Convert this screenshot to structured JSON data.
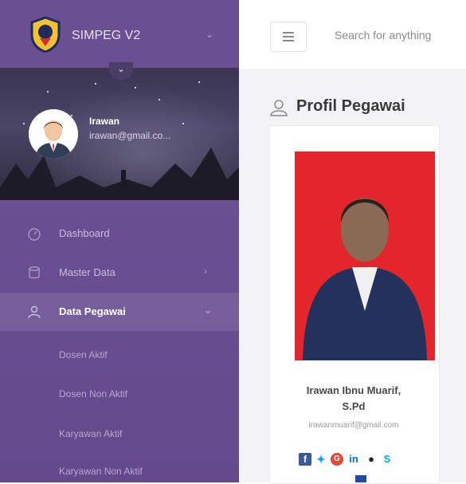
{
  "brand": {
    "title": "SIMPEG V2"
  },
  "profile": {
    "name": "Irawan",
    "email": "irawan@gmail.co..."
  },
  "menu": [
    {
      "label": "Dashboard",
      "icon": "dashboard-icon",
      "active": false,
      "has_children": false
    },
    {
      "label": "Master Data",
      "icon": "database-icon",
      "active": false,
      "has_children": true
    },
    {
      "label": "Data Pegawai",
      "icon": "user-icon",
      "active": true,
      "has_children": true
    }
  ],
  "submenu": [
    "Dosen Aktif",
    "Dosen Non Aktif",
    "Karyawan Aktif",
    "Karyawan Non Aktif"
  ],
  "search": {
    "placeholder": "Search for anything"
  },
  "page": {
    "title": "Profil Pegawai"
  },
  "employee": {
    "name_line1": "Irawan Ibnu Muarif,",
    "name_line2": "S.Pd",
    "email": "irawanmuarif@gmail.com"
  },
  "social_icons": [
    "facebook-icon",
    "twitter-icon",
    "google-plus-icon",
    "linkedin-icon",
    "reddit-icon",
    "skype-icon"
  ],
  "colors": {
    "sidebar": "#6a4f93",
    "photo_background": "#e2262b",
    "facebook": "#3b5998",
    "twitter": "#1da1f2",
    "google": "#dd4b39",
    "linkedin": "#0077b5",
    "reddit": "#222222",
    "skype": "#00aff0"
  }
}
